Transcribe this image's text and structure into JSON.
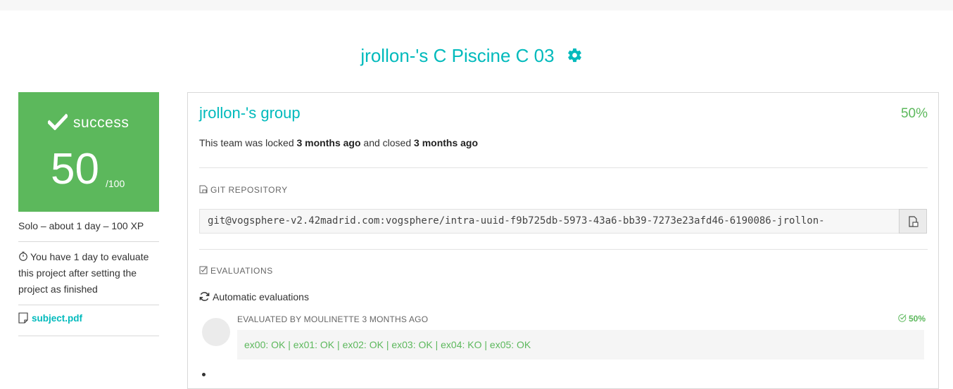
{
  "header": {
    "title": "jrollon-'s C Piscine C 03",
    "settings_icon": "gear-icon"
  },
  "status_card": {
    "status_label": "success",
    "score": "50",
    "score_max": "/100",
    "color": "#5cb85c"
  },
  "sidebar": {
    "meta": "Solo – about 1 day – 100 XP",
    "deadline_text": "You have 1 day to evaluate this project after setting the project as finished",
    "subject_link": "subject.pdf"
  },
  "team": {
    "name": "jrollon-'s group",
    "percent": "50%",
    "lock_prefix": "This team was locked ",
    "locked_when": "3 months ago",
    "lock_middle": " and closed ",
    "closed_when": "3 months ago"
  },
  "git": {
    "section_label": "GIT REPOSITORY",
    "url": "git@vogsphere-v2.42madrid.com:vogsphere/intra-uuid-f9b725db-5973-43a6-bb39-7273e23afd46-6190086-jrollon-"
  },
  "evaluations": {
    "section_label": "EVALUATIONS",
    "auto_label": "Automatic evaluations",
    "items": [
      {
        "evaluator": "EVALUATED BY MOULINETTE 3 MONTHS AGO",
        "score": "50%",
        "result": "ex00: OK | ex01: OK | ex02: OK | ex03: OK | ex04: KO | ex05: OK"
      }
    ]
  },
  "colors": {
    "accent": "#00babc",
    "success": "#5cb85c"
  }
}
